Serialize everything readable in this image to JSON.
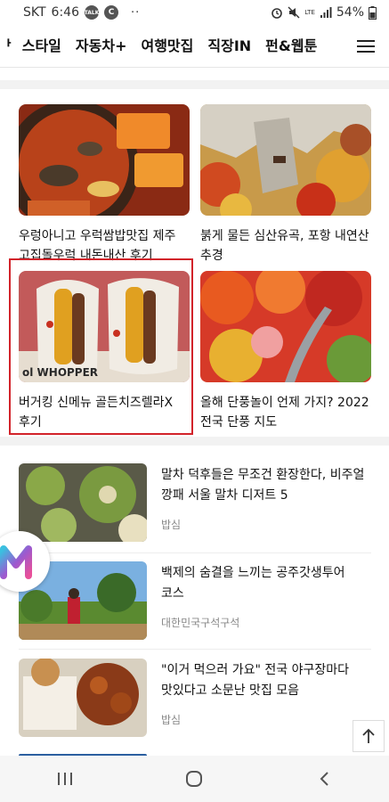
{
  "status_bar": {
    "carrier": "SKT",
    "time": "6:46",
    "talk_badge": "TALK",
    "c_badge": "C",
    "dots": "··",
    "lte": "LTE",
    "battery": "54%"
  },
  "nav": {
    "tabs": [
      {
        "label": "ᅡ"
      },
      {
        "label": "스타일"
      },
      {
        "label": "자동차+"
      },
      {
        "label": "여행맛집"
      },
      {
        "label": "직장IN"
      },
      {
        "label": "펀&웹툰"
      }
    ],
    "active_index": 3
  },
  "grid": [
    {
      "title": "우렁아니고 우럭쌈밥맛집 제주 고집돌우럭 내돈내산 후기"
    },
    {
      "title": "붉게 물든 심산유곡, 포항 내연산 추경"
    },
    {
      "title": "버거킹 신메뉴 골든치즈렐라X 후기",
      "image_text": "ol WHOPPER"
    },
    {
      "title": "올해 단풍놀이 언제 가지? 2022 전국 단풍 지도"
    }
  ],
  "list": [
    {
      "title": "말차 덕후들은 무조건 환장한다, 비주얼 깡패 서울 말차 디저트 5",
      "source": "밥심"
    },
    {
      "title": "백제의 숨결을 느끼는 공주갓생투어 코스",
      "source": "대한민국구석구석"
    },
    {
      "title": "\"이거 먹으러 가요\" 전국 야구장마다 맛있다고 소문난 맛집 모음",
      "source": "밥심"
    }
  ],
  "colors": {
    "highlight": "#d2232a",
    "divider": "#f2f2f2",
    "source_text": "#888888"
  }
}
